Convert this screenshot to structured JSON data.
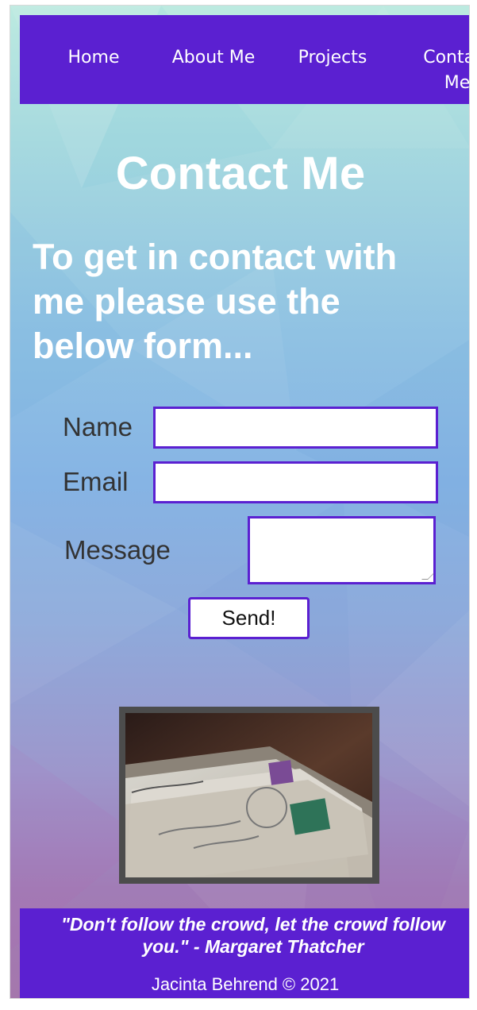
{
  "nav": {
    "home": "Home",
    "about": "About Me",
    "projects": "Projects",
    "contact": "Contact Me"
  },
  "page": {
    "title": "Contact Me",
    "intro": "To get in contact with me please use the below form..."
  },
  "form": {
    "name_label": "Name",
    "email_label": "Email",
    "message_label": "Message",
    "name_value": "",
    "email_value": "",
    "message_value": "",
    "send_label": "Send!"
  },
  "footer": {
    "quote": "\"Don't follow the crowd, let the crowd follow you.\" - Margaret Thatcher",
    "copyright": "Jacinta Behrend © 2021"
  },
  "colors": {
    "accent": "#5b20d1",
    "text_light": "#ffffff",
    "text_dark": "#333333"
  },
  "icons": {
    "resize": "resize-handle-icon",
    "photo": "letters-photo-icon"
  }
}
